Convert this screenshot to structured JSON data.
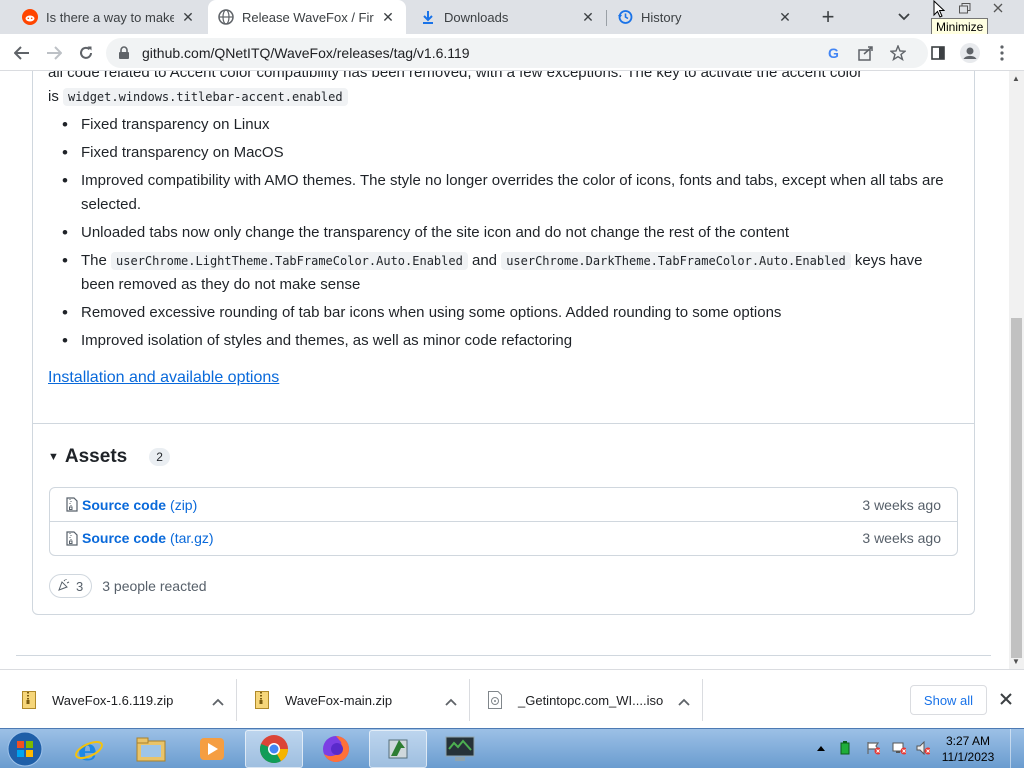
{
  "tabs": [
    {
      "label": "Is there a way to make Fire",
      "icon": "reddit-icon"
    },
    {
      "label": "Release WaveFox / Firefox",
      "icon": "globe-icon"
    },
    {
      "label": "Downloads",
      "icon": "download-icon"
    },
    {
      "label": "History",
      "icon": "history-icon"
    }
  ],
  "tooltip": "Minimize",
  "address": {
    "url": "github.com/QNetITQ/WaveFox/releases/tag/v1.6.119"
  },
  "release": {
    "partial_line": "all code related to Accent color compatibility has been removed, with a few exceptions. The key to activate the accent color",
    "partial_is": "is",
    "partial_code": "widget.windows.titlebar-accent.enabled",
    "notes": [
      "Fixed transparency on Linux",
      "Fixed transparency on MacOS",
      "Improved compatibility with AMO themes. The style no longer overrides the color of icons, fonts and tabs, except when all tabs are selected.",
      "Unloaded tabs now only change the transparency of the site icon and do not change the rest of the content"
    ],
    "keys_note": {
      "pre": "The",
      "code1": "userChrome.LightTheme.TabFrameColor.Auto.Enabled",
      "mid": "and",
      "code2": "userChrome.DarkTheme.TabFrameColor.Auto.Enabled",
      "post": "keys have been removed as they do not make sense"
    },
    "notes2": [
      "Removed excessive rounding of tab bar icons when using some options. Added rounding to some options",
      "Improved isolation of styles and themes, as well as minor code refactoring"
    ],
    "link": "Installation and available options"
  },
  "assets": {
    "title": "Assets",
    "count": "2",
    "items": [
      {
        "name": "Source code",
        "ext": "(zip)",
        "time": "3 weeks ago"
      },
      {
        "name": "Source code",
        "ext": "(tar.gz)",
        "time": "3 weeks ago"
      }
    ]
  },
  "reactions": {
    "count": "3",
    "text": "3 people reacted"
  },
  "downloads": {
    "items": [
      {
        "name": "WaveFox-1.6.119.zip"
      },
      {
        "name": "WaveFox-main.zip"
      },
      {
        "name": "_Getintopc.com_WI....iso"
      }
    ],
    "show_all": "Show all"
  },
  "taskbar": {
    "time": "3:27 AM",
    "date": "11/1/2023"
  },
  "colors": {
    "accent": "#0969da",
    "tabstrip": "#dee1e6"
  }
}
